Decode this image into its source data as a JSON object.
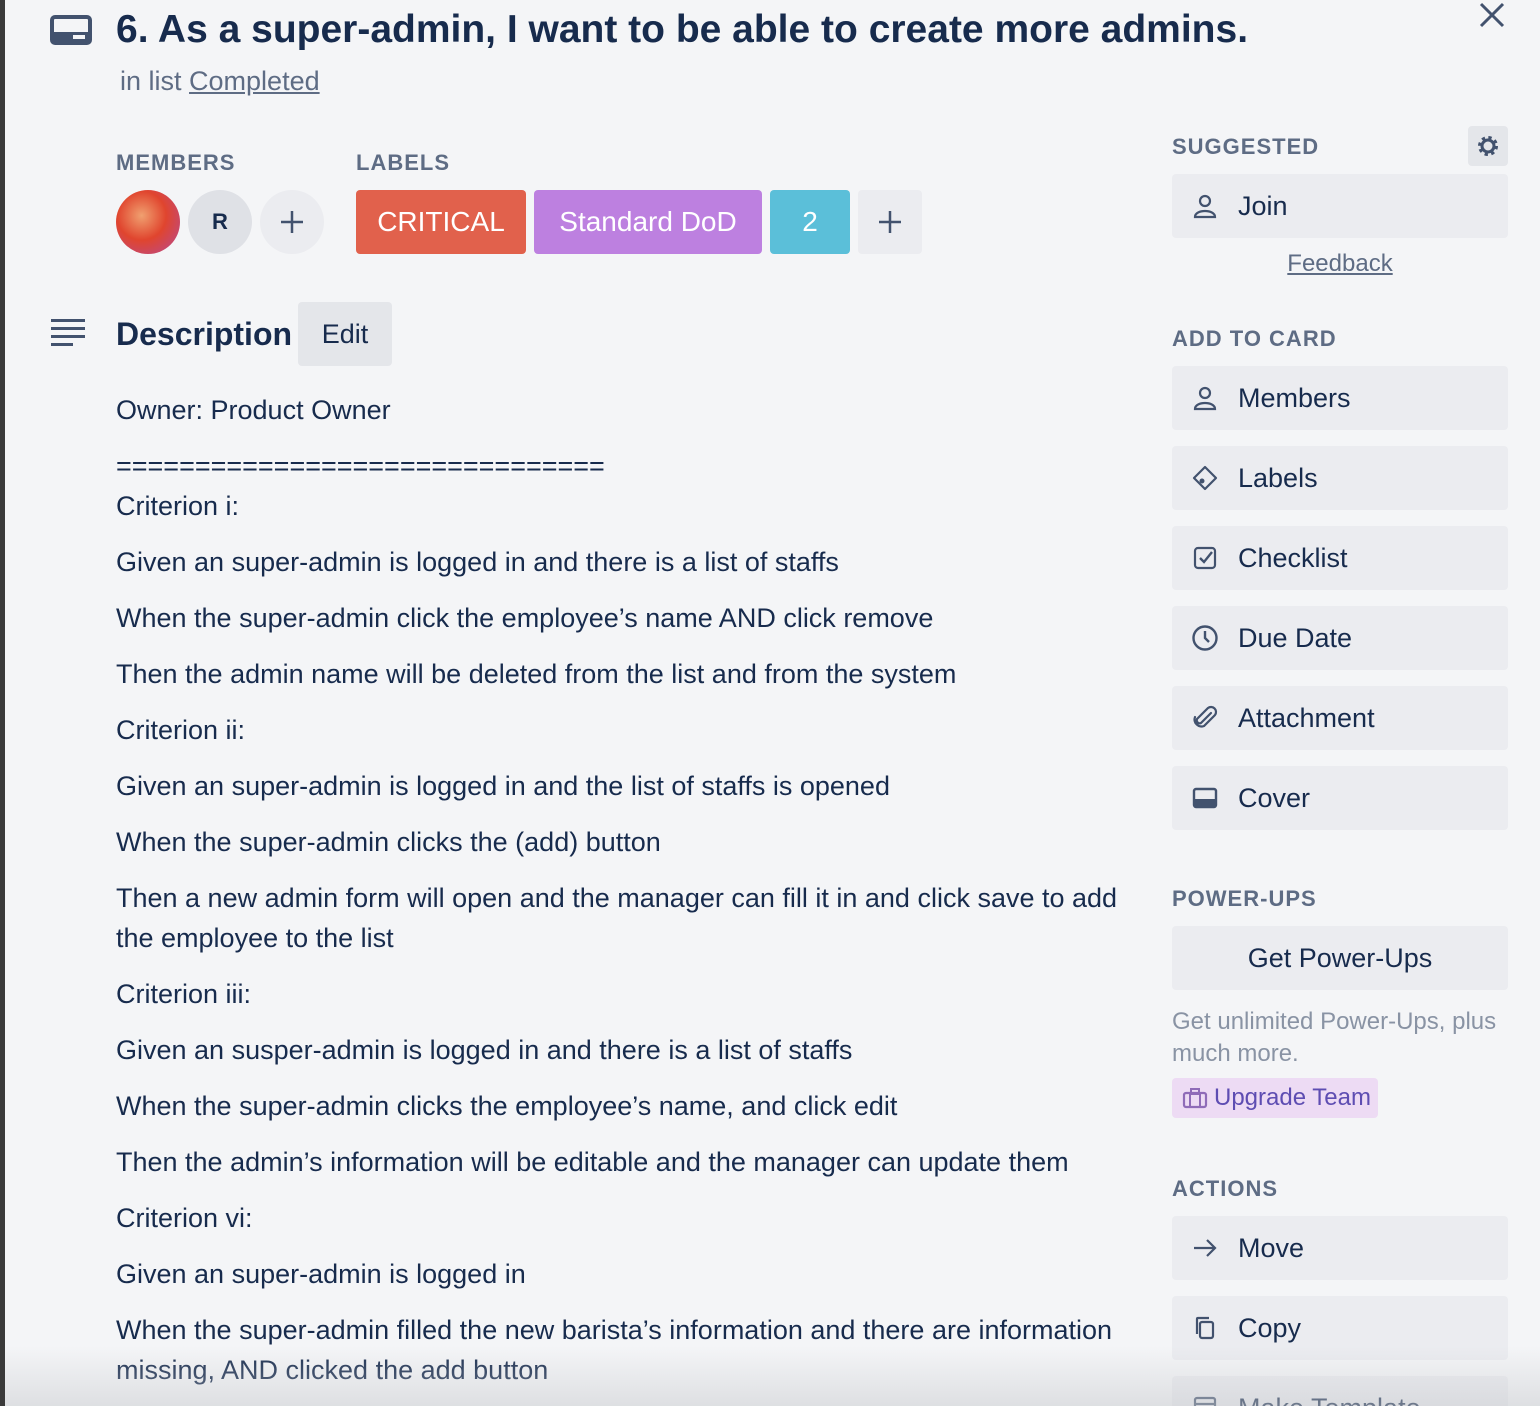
{
  "card": {
    "title": "6. As a super-admin, I want to be able to create more admins.",
    "in_list_prefix": "in list",
    "list_name": "Completed"
  },
  "members": {
    "heading": "MEMBERS",
    "avatar_initial": "R"
  },
  "labels": {
    "heading": "LABELS",
    "items": [
      {
        "text": "CRITICAL",
        "color": "#e1614c"
      },
      {
        "text": "Standard DoD",
        "color": "#bd80e0"
      },
      {
        "text": "2",
        "color": "#5bbfd9"
      }
    ]
  },
  "description": {
    "heading": "Description",
    "edit_label": "Edit",
    "lines": [
      "Owner: Product Owner",
      "===============================",
      "Criterion i:",
      "Given an super-admin is logged in and there is a list of staffs",
      "When the super-admin click the employee’s name AND click remove",
      "Then the admin name will be deleted from the list and from the system",
      "Criterion ii:",
      "Given an super-admin is logged in and the list of staffs is opened",
      "When the super-admin clicks the (add) button",
      "Then a new admin form will open and the manager can fill it in and click save to add the employee to the list",
      "Criterion iii:",
      "Given an susper-admin is logged in and there is a list of staffs",
      "When the super-admin clicks the employee’s name, and click edit",
      "Then the admin’s information will be editable and the manager can update them",
      "Criterion vi:",
      "Given an super-admin is logged in",
      "When the super-admin filled the new barista’s information and there are information missing, AND clicked the add button"
    ]
  },
  "sidebar": {
    "suggested_heading": "SUGGESTED",
    "join_label": "Join",
    "feedback_label": "Feedback",
    "add_to_card_heading": "ADD TO CARD",
    "add_to_card": [
      {
        "label": "Members",
        "icon": "person-icon"
      },
      {
        "label": "Labels",
        "icon": "tag-icon"
      },
      {
        "label": "Checklist",
        "icon": "checklist-icon"
      },
      {
        "label": "Due Date",
        "icon": "clock-icon"
      },
      {
        "label": "Attachment",
        "icon": "paperclip-icon"
      },
      {
        "label": "Cover",
        "icon": "cover-icon"
      }
    ],
    "power_ups_heading": "POWER-UPS",
    "get_power_ups_label": "Get Power-Ups",
    "power_ups_note": "Get unlimited Power-Ups, plus much more.",
    "upgrade_label": "Upgrade Team",
    "actions_heading": "ACTIONS",
    "actions": [
      {
        "label": "Move",
        "icon": "arrow-right-icon"
      },
      {
        "label": "Copy",
        "icon": "copy-icon"
      },
      {
        "label": "Make Template",
        "icon": "template-icon"
      }
    ]
  }
}
